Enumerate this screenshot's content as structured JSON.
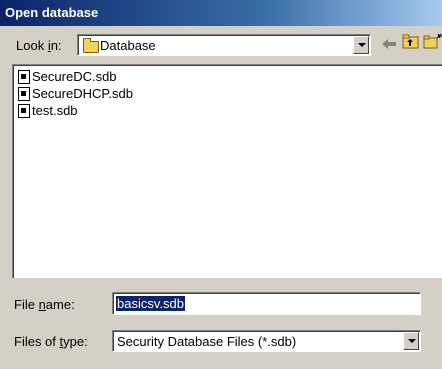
{
  "window": {
    "title": "Open database"
  },
  "look_in": {
    "label_prefix": "Look ",
    "label_hotkey": "i",
    "label_suffix": "n:",
    "value": "Database"
  },
  "toolbar": {
    "back_icon": "back-arrow-icon",
    "up_icon": "up-folder-icon",
    "new_folder_icon": "new-folder-icon"
  },
  "files": [
    {
      "name": "SecureDC.sdb"
    },
    {
      "name": "SecureDHCP.sdb"
    },
    {
      "name": "test.sdb"
    }
  ],
  "file_name": {
    "label_prefix": "File ",
    "label_hotkey": "n",
    "label_suffix": "ame:",
    "value": "basicsv.sdb"
  },
  "file_type": {
    "label_prefix": "Files of ",
    "label_hotkey": "t",
    "label_suffix": "ype:",
    "value": "Security Database Files (*.sdb)"
  },
  "colors": {
    "dialog_bg": "#d4d0c8",
    "title_start": "#0a246a",
    "title_end": "#a6caf0",
    "selection": "#0a246a"
  }
}
